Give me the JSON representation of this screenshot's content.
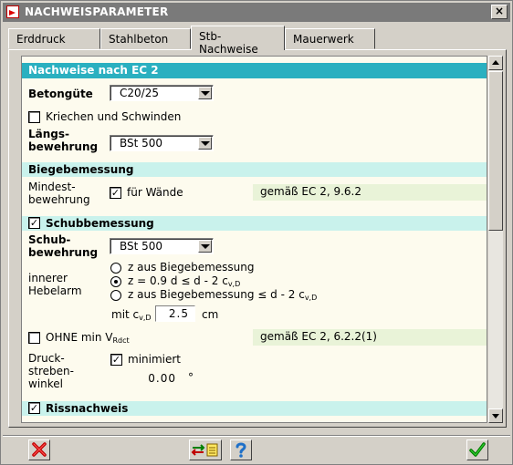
{
  "window": {
    "title": "NACHWEISPARAMETER",
    "close": "×"
  },
  "tabs": [
    {
      "label": "Erddruck"
    },
    {
      "label": "Stahlbeton"
    },
    {
      "label": "Stb-Nachweise",
      "active": true
    },
    {
      "label": "Mauerwerk"
    }
  ],
  "main": {
    "header": "Nachweise nach EC 2",
    "betongute": {
      "label": "Betongüte",
      "value": "C20/25"
    },
    "kriechen": {
      "label": "Kriechen und Schwinden",
      "checked": false
    },
    "langs": {
      "label1": "Längs-",
      "label2": "bewehrung",
      "value": "BSt 500"
    },
    "biege": {
      "header": "Biegebemessung",
      "mindest1": "Mindest-",
      "mindest2": "bewehrung",
      "fuer_waende": "für Wände",
      "checked": true,
      "ref": "gemäß EC 2, 9.6.2"
    },
    "schub": {
      "header": "Schubbemessung",
      "checked": true,
      "bew1": "Schub-",
      "bew2": "bewehrung",
      "bew_value": "BSt 500",
      "hebel1": "innerer",
      "hebel2": "Hebelarm",
      "radio1": "z aus Biegebemessung",
      "radio2_a": "z = 0.9 d ≤ d - 2 c",
      "radio2_sub": "v,D",
      "radio3_a": "z aus Biegebemessung ≤ d - 2 c",
      "radio3_sub": "v,D",
      "selected_radio": 2,
      "mit_a": "mit c",
      "mit_sub": "v,D",
      "cv_value": "2.5",
      "cv_unit": "cm",
      "ohne_a": "OHNE min V",
      "ohne_sub": "Rdct",
      "ohne_checked": false,
      "ohne_ref": "gemäß EC 2, 6.2.2(1)",
      "druck1": "Druck-",
      "druck2": "streben-",
      "druck3": "winkel",
      "minimiert": "minimiert",
      "minimiert_checked": true,
      "angle_value": "0.00",
      "angle_unit": "°"
    },
    "riss": {
      "header": "Rissnachweis",
      "checked": true
    }
  },
  "colors": {
    "header_main": "#2ab0c0",
    "header_sub": "#c9f2ec",
    "content_bg": "#fdfbee",
    "ref_bg": "#e9f3d8"
  },
  "footer": {
    "cancel_icon": "red-x-icon",
    "transfer_icon": "transfer-icon",
    "help_icon": "help-icon",
    "ok_icon": "green-check-icon"
  }
}
